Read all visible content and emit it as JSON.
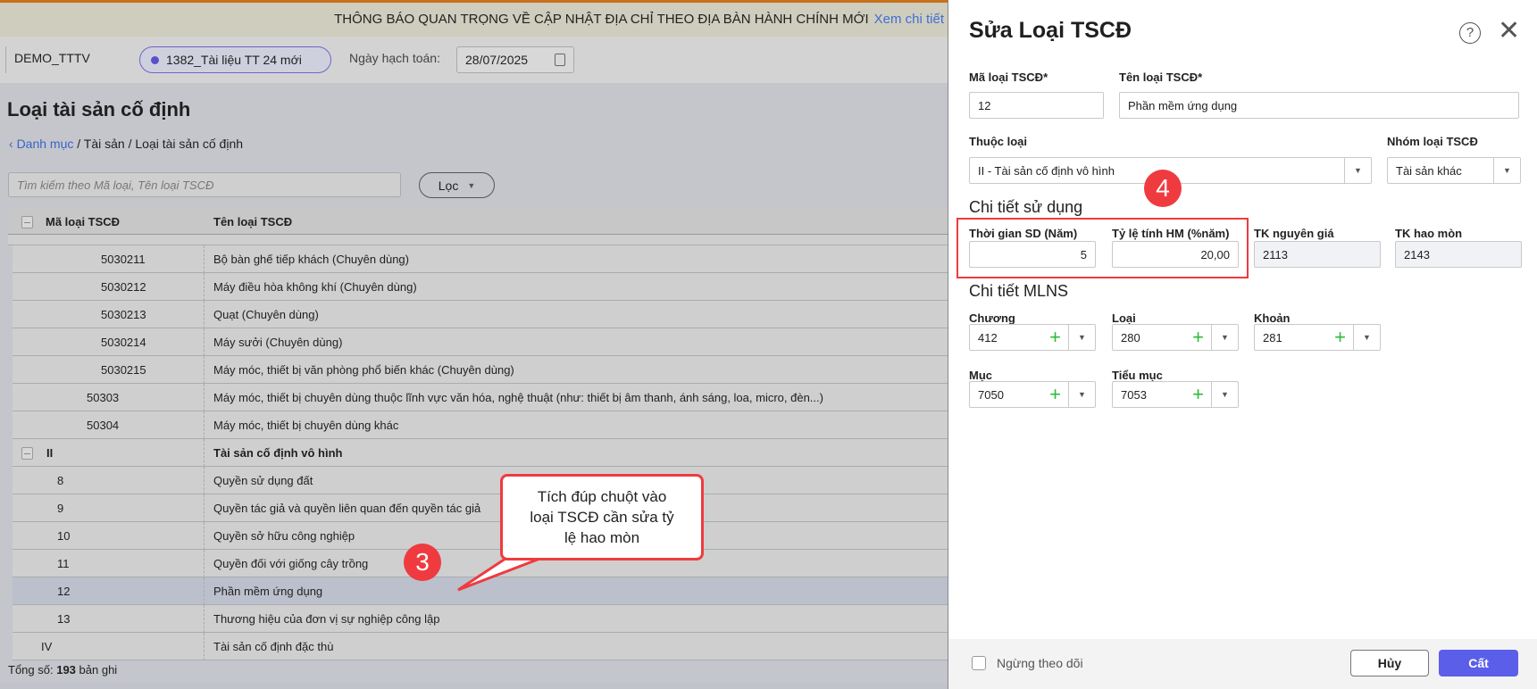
{
  "banner": {
    "text": "THÔNG BÁO QUAN TRỌNG VỀ CẬP NHẬT ĐỊA CHỈ THEO ĐỊA BÀN HÀNH CHÍNH MỚI",
    "link": "Xem chi tiết"
  },
  "header": {
    "org": "DEMO_TTTV",
    "dataset": "1382_Tài liệu TT 24 mới",
    "date_label": "Ngày hạch toán:",
    "date": "28/07/2025"
  },
  "page": {
    "title": "Loại tài sản cố định",
    "breadcrumb": {
      "back": "Danh mục",
      "sep1": " / Tài sản / ",
      "current": "Loại tài sản cố định"
    },
    "search_placeholder": "Tìm kiếm theo Mã loại, Tên loại TSCĐ",
    "filter": "Lọc"
  },
  "table": {
    "columns": [
      "Mã loại TSCĐ",
      "Tên loại TSCĐ"
    ],
    "rows": [
      {
        "code": "5030211",
        "name": "Bộ bàn ghế tiếp khách (Chuyên dùng)"
      },
      {
        "code": "5030212",
        "name": "Máy điều hòa không khí (Chuyên dùng)"
      },
      {
        "code": "5030213",
        "name": "Quạt (Chuyên dùng)"
      },
      {
        "code": "5030214",
        "name": "Máy sưởi (Chuyên dùng)"
      },
      {
        "code": "5030215",
        "name": "Máy móc, thiết bị văn phòng phổ biến khác (Chuyên dùng)"
      },
      {
        "code": "50303",
        "name": "Máy móc, thiết bị chuyên dùng thuộc lĩnh vực văn hóa, nghệ thuật (như: thiết bị âm thanh, ánh sáng, loa, micro, đèn...)"
      },
      {
        "code": "50304",
        "name": "Máy móc, thiết bị chuyên dùng khác"
      },
      {
        "code": "II",
        "name": "Tài sản cố định vô hình"
      },
      {
        "code": "8",
        "name": "Quyền sử dụng đất"
      },
      {
        "code": "9",
        "name": "Quyền tác giả và quyền liên quan đến quyền tác giả"
      },
      {
        "code": "10",
        "name": "Quyền sở hữu công nghiệp"
      },
      {
        "code": "11",
        "name": "Quyền đối với giống cây trồng"
      },
      {
        "code": "12",
        "name": "Phần mềm ứng dụng"
      },
      {
        "code": "13",
        "name": "Thương hiệu của đơn vị sự nghiệp công lập"
      },
      {
        "code": "IV",
        "name": "Tài sản cố định đặc thù"
      }
    ],
    "total_label": "Tổng số:",
    "total": "193",
    "total_unit": "bản ghi"
  },
  "callout": {
    "text": "Tích đúp chuột vào loại TSCĐ cần sửa tỷ lệ hao mòn",
    "step3": "3",
    "step4": "4"
  },
  "dialog": {
    "title": "Sửa Loại TSCĐ",
    "ma_label": "Mã loại TSCĐ*",
    "ma": "12",
    "ten_label": "Tên loại TSCĐ*",
    "ten": "Phần mềm ứng dụng",
    "thuoc_label": "Thuộc loại",
    "thuoc": "II - Tài sản cố định vô hình",
    "nhom_label": "Nhóm loại TSCĐ",
    "nhom": "Tài sản khác",
    "sec1": "Chi tiết sử dụng",
    "tg_label": "Thời gian SD (Năm)",
    "tg": "5",
    "tl_label": "Tỷ lệ tính HM (%năm)",
    "tl": "20,00",
    "tkng_label": "TK nguyên giá",
    "tkng": "2113",
    "tkhm_label": "TK hao mòn",
    "tkhm": "2143",
    "sec2": "Chi tiết MLNS",
    "mlns": [
      {
        "label": "Chương",
        "value": "412"
      },
      {
        "label": "Loại",
        "value": "280"
      },
      {
        "label": "Khoản",
        "value": "281"
      },
      {
        "label": "Mục",
        "value": "7050"
      },
      {
        "label": "Tiểu mục",
        "value": "7053"
      }
    ],
    "stop_label": "Ngừng theo dõi",
    "cancel": "Hủy",
    "save": "Cất"
  },
  "colors": {
    "accent": "#5b5ee8",
    "callout": "#ef3b3f",
    "selected_row": "#bcc0cc"
  }
}
